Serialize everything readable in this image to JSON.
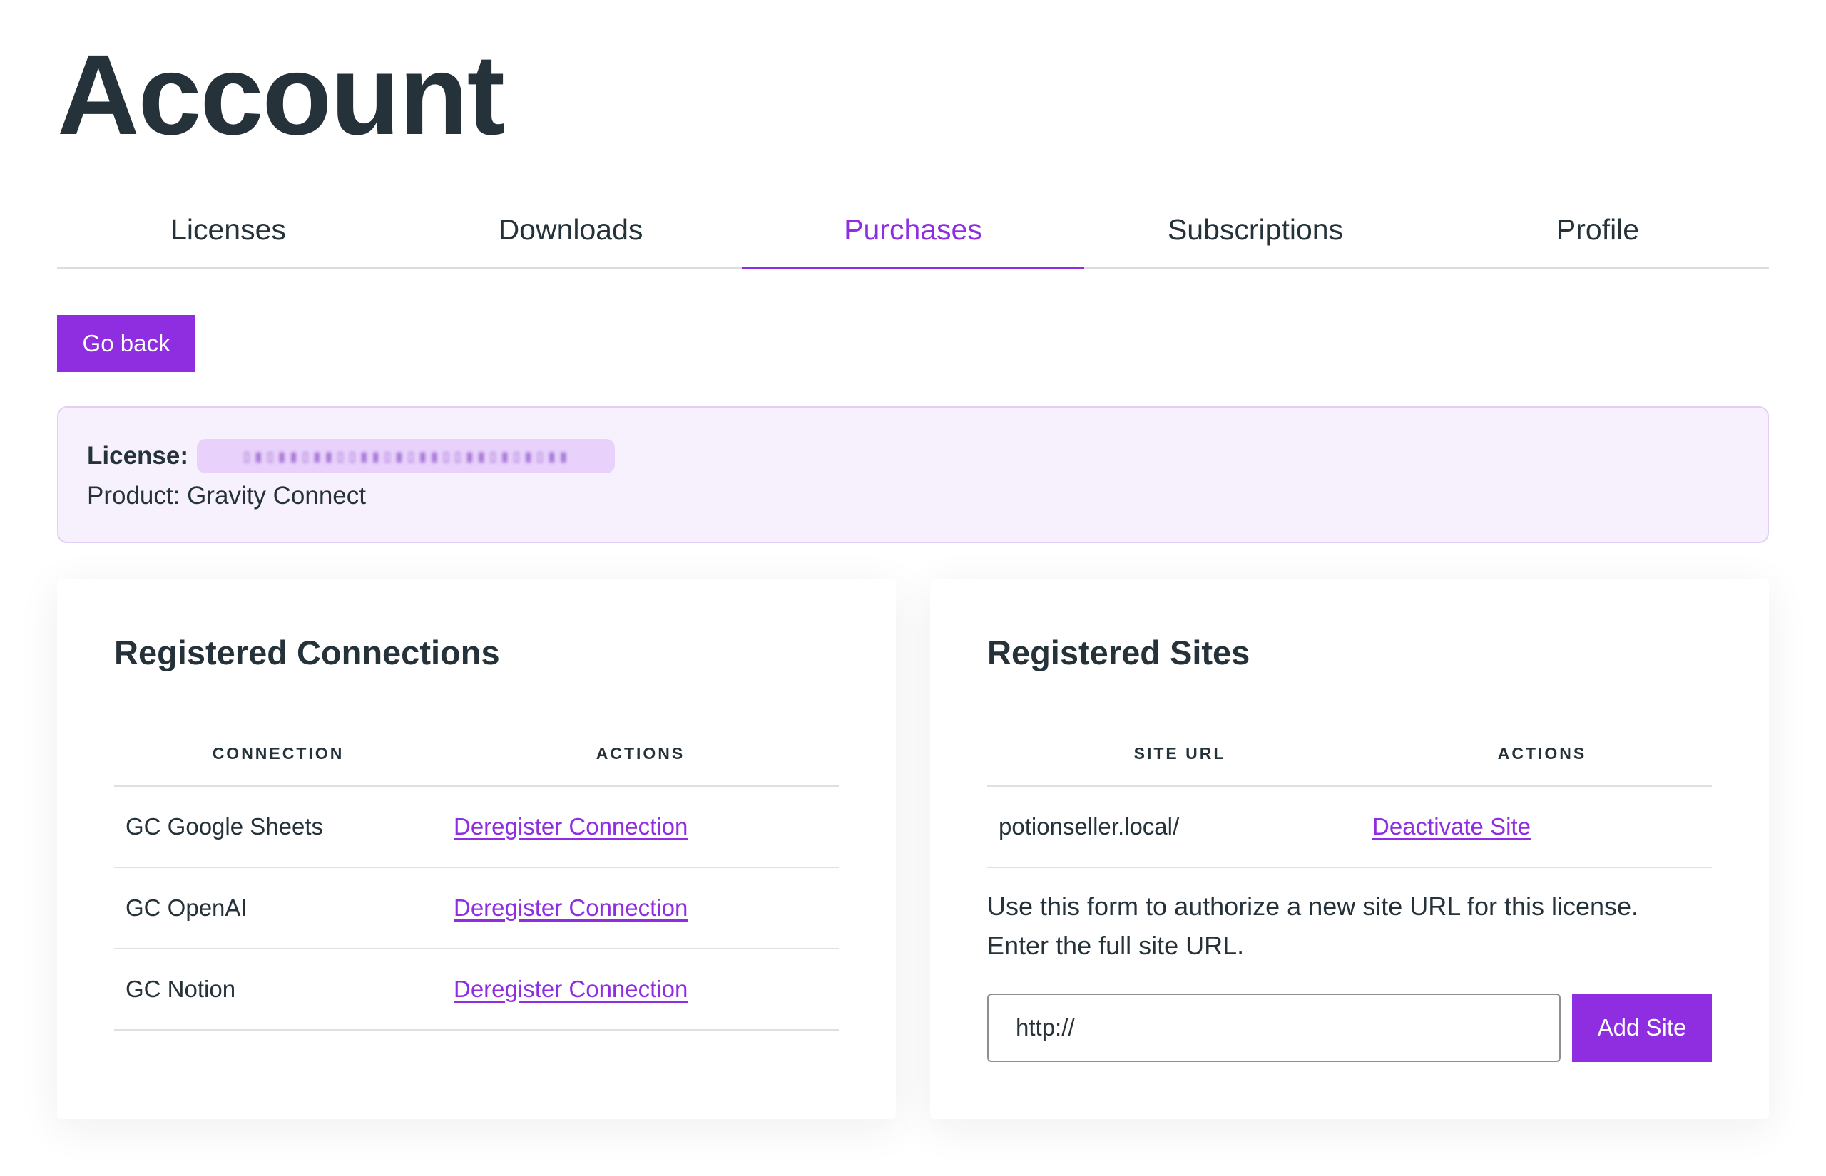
{
  "page": {
    "title": "Account"
  },
  "tabs": [
    {
      "label": "Licenses",
      "active": false
    },
    {
      "label": "Downloads",
      "active": false
    },
    {
      "label": "Purchases",
      "active": true
    },
    {
      "label": "Subscriptions",
      "active": false
    },
    {
      "label": "Profile",
      "active": false
    }
  ],
  "actions": {
    "go_back_label": "Go back"
  },
  "license": {
    "label": "License:",
    "key_redacted": "▯▮▯▮▮▯▮▮▯▯▮▮▯▮▯▮▮▯▯▮▮▯▮▯▮▯▮▮",
    "product_text": "Product: Gravity Connect"
  },
  "connections": {
    "title": "Registered Connections",
    "headers": [
      "CONNECTION",
      "ACTIONS"
    ],
    "rows": [
      {
        "name": "GC Google Sheets",
        "action": "Deregister Connection"
      },
      {
        "name": "GC OpenAI",
        "action": "Deregister Connection"
      },
      {
        "name": "GC Notion",
        "action": "Deregister Connection"
      }
    ]
  },
  "sites": {
    "title": "Registered Sites",
    "headers": [
      "SITE URL",
      "ACTIONS"
    ],
    "rows": [
      {
        "url": "potionseller.local/",
        "action": "Deactivate Site"
      }
    ],
    "help_line1": "Use this form to authorize a new site URL for this license.",
    "help_line2": "Enter the full site URL.",
    "input_value": "http://",
    "add_label": "Add Site"
  },
  "colors": {
    "accent": "#8e2ee0",
    "text": "#25323a",
    "license_bg": "#f7f1fe",
    "license_border": "#e2cff7"
  }
}
